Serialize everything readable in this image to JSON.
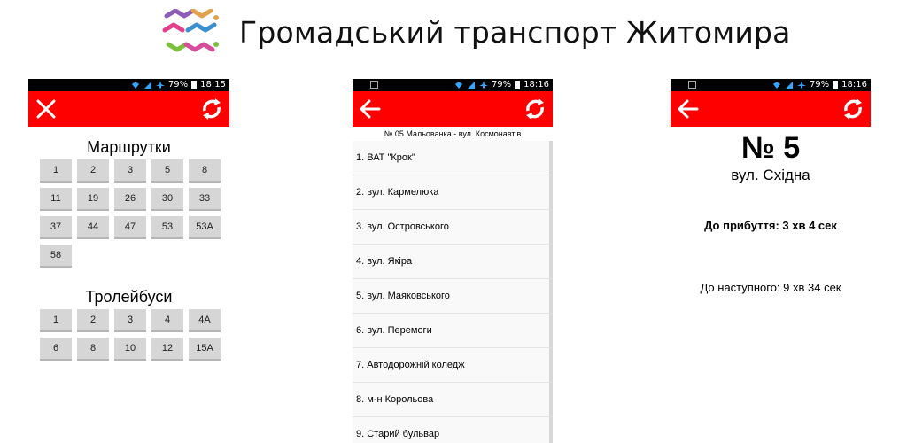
{
  "header": {
    "title": "Громадський транспорт Житомира"
  },
  "status_bar": {
    "screen1": {
      "battery": "79%",
      "time": "18:15"
    },
    "screen2": {
      "battery": "79%",
      "time": "18:16"
    },
    "screen3": {
      "battery": "79%",
      "time": "18:16"
    }
  },
  "screen1": {
    "minibuses_title": "Маршрутки",
    "minibuses": [
      "1",
      "2",
      "3",
      "5",
      "8",
      "11",
      "19",
      "26",
      "30",
      "33",
      "37",
      "44",
      "47",
      "53",
      "53А",
      "58"
    ],
    "trolleybuses_title": "Тролейбуси",
    "trolleybuses": [
      "1",
      "2",
      "3",
      "4",
      "4А",
      "6",
      "8",
      "10",
      "12",
      "15А"
    ]
  },
  "screen2": {
    "route_title": "№ 05 Мальованка - вул. Космонавтів",
    "stops": [
      "1. ВАТ \"Крок\"",
      "2. вул. Кармелюка",
      "3. вул. Островського",
      "4. вул. Якіра",
      "5. вул. Маяковського",
      "6. вул. Перемоги",
      "7. Автодорожній коледж",
      "8. м-н Корольова",
      "9. Старий бульвар"
    ]
  },
  "screen3": {
    "route_number": "№ 5",
    "stop_name": "вул. Східна",
    "arrival": "До прибуття: 3 хв 4 сек",
    "next": "До наступного: 9 хв 34 сек"
  },
  "icons": {
    "close": "close-icon",
    "back": "arrow-left-icon",
    "refresh": "refresh-icon",
    "wifi": "wifi-icon",
    "signal": "signal-icon",
    "airplane": "airplane-icon",
    "battery": "battery-icon"
  },
  "colors": {
    "toolbar": "#ff0000",
    "status_bar": "#000000",
    "button": "#d6d6d6"
  }
}
